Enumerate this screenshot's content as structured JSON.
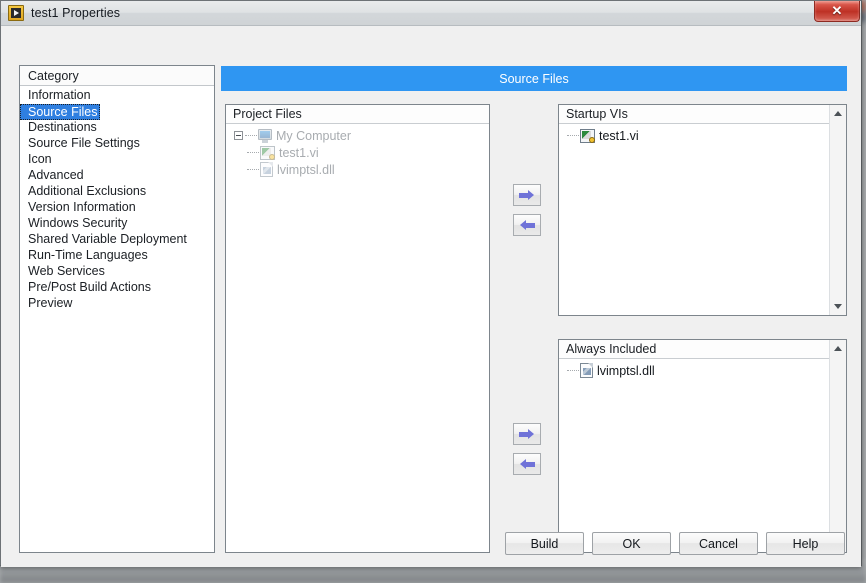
{
  "window": {
    "title": "test1 Properties",
    "icon": "labview-vi-icon",
    "close_label": "✕"
  },
  "category_panel": {
    "header": "Category",
    "items": [
      {
        "label": "Information",
        "selected": false
      },
      {
        "label": "Source Files",
        "selected": true
      },
      {
        "label": "Destinations",
        "selected": false
      },
      {
        "label": "Source File Settings",
        "selected": false
      },
      {
        "label": "Icon",
        "selected": false
      },
      {
        "label": "Advanced",
        "selected": false
      },
      {
        "label": "Additional Exclusions",
        "selected": false
      },
      {
        "label": "Version Information",
        "selected": false
      },
      {
        "label": "Windows Security",
        "selected": false
      },
      {
        "label": "Shared Variable Deployment",
        "selected": false
      },
      {
        "label": "Run-Time Languages",
        "selected": false
      },
      {
        "label": "Web Services",
        "selected": false
      },
      {
        "label": "Pre/Post Build Actions",
        "selected": false
      },
      {
        "label": "Preview",
        "selected": false
      }
    ]
  },
  "section_header": {
    "title": "Source Files",
    "color": "#2f96f2"
  },
  "project_files": {
    "header": "Project Files",
    "nodes": [
      {
        "label": "My Computer",
        "icon": "computer-icon",
        "level": 0,
        "dimmed": true,
        "expanded": true
      },
      {
        "label": "test1.vi",
        "icon": "vi-icon",
        "level": 1,
        "dimmed": true
      },
      {
        "label": "lvimptsl.dll",
        "icon": "dll-icon",
        "level": 1,
        "dimmed": true
      }
    ]
  },
  "startup_vis": {
    "header": "Startup VIs",
    "nodes": [
      {
        "label": "test1.vi",
        "icon": "vi-icon",
        "level": 1,
        "dimmed": false
      }
    ]
  },
  "always_included": {
    "header": "Always Included",
    "nodes": [
      {
        "label": "lvimptsl.dll",
        "icon": "dll-icon",
        "level": 1,
        "dimmed": false
      }
    ]
  },
  "transfer_buttons": {
    "startup_add": "add-to-startup-vis",
    "startup_remove": "remove-from-startup-vis",
    "included_add": "add-to-always-included",
    "included_remove": "remove-from-always-included",
    "arrow_color": "#6f72d8"
  },
  "footer_buttons": [
    {
      "label": "Build"
    },
    {
      "label": "OK"
    },
    {
      "label": "Cancel"
    },
    {
      "label": "Help"
    }
  ]
}
